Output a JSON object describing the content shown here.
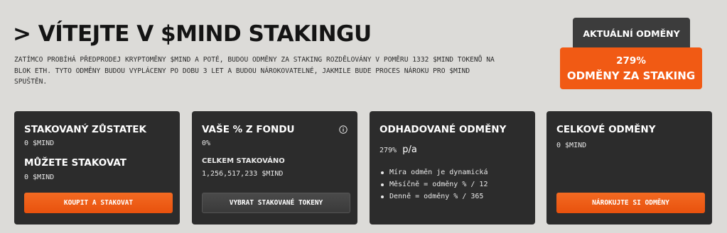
{
  "header": {
    "title": "> VÍTEJTE V $MIND STAKINGU",
    "intro": "ZATÍMCO PROBÍHÁ PŘEDPRODEJ KRYPTOMĚNY $MIND A POTÉ, BUDOU ODMĚNY ZA STAKING ROZDĚLOVÁNY V POMĚRU 1332 $MIND TOKENŮ NA BLOK ETH. TYTO ODMĚNY BUDOU VYPLÁCENY PO DOBU 3 LET A BUDOU NÁROKOVATELNÉ, JAKMILE BUDE PROCES NÁROKU PRO $MIND SPUŠTĚN."
  },
  "rewards": {
    "tab_label": "AKTUÁLNÍ ODMĚNY",
    "percent": "279%",
    "label": "ODMĚNY ZA STAKING"
  },
  "cards": {
    "balance": {
      "title": "STAKOVANÝ ZŮSTATEK",
      "value": "0 $MIND",
      "subtitle": "MŮŽETE STAKOVAT",
      "subvalue": "0 $MIND",
      "button": "KOUPIT A STAKOVAT"
    },
    "pool": {
      "title": "VAŠE % Z FONDU",
      "value": "0%",
      "subtitle": "CELKEM STAKOVÁNO",
      "subvalue": "1,256,517,233 $MIND",
      "button": "VYBRAT STAKOVANÉ TOKENY"
    },
    "estimated": {
      "title": "ODHADOVANÉ ODMĚNY",
      "rate": "279%",
      "rate_unit": "p/a",
      "bullets": [
        "Míra odměn je dynamická",
        "Měsíčně = odměny % / 12",
        "Denně = odměny % / 365"
      ]
    },
    "total": {
      "title": "CELKOVÉ ODMĚNY",
      "value": "0 $MIND",
      "button": "NÁROKUJTE SI ODMĚNY"
    }
  },
  "colors": {
    "accent": "#f15a14",
    "card_bg": "#2c2c2c",
    "page_bg": "#dcdbd8"
  },
  "icons": {
    "info": "info-circle-icon"
  }
}
